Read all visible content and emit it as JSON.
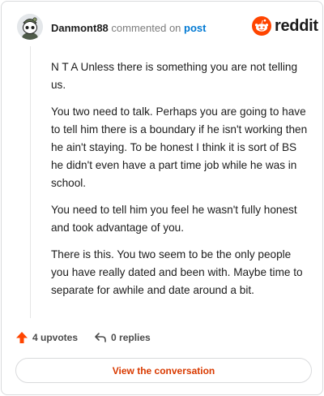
{
  "comment": {
    "author": "Danmont88",
    "action_text": "commented on",
    "post_link": "post",
    "paragraphs": [
      "N T A Unless there is something you are not telling us.",
      "You two need to talk. Perhaps you are going to have to tell him there is a boundary if he isn't working then he ain't staying. To be honest I think it is sort of BS he didn't even have a part time job while he was in school.",
      "You need to tell him you feel he wasn't fully honest and took advantage of you.",
      "There is this. You two seem to be the only people you have really dated and been with. Maybe time to separate for awhile and date around a bit."
    ]
  },
  "brand": {
    "wordmark": "reddit",
    "icon": "reddit-snoo-icon",
    "color": "#ff4500"
  },
  "actions": {
    "upvotes_label": "4 upvotes",
    "replies_label": "0 replies"
  },
  "cta": {
    "label": "View the conversation"
  },
  "colors": {
    "link": "#0079d3",
    "upvote": "#ff4500",
    "cta_text": "#d93a00"
  }
}
